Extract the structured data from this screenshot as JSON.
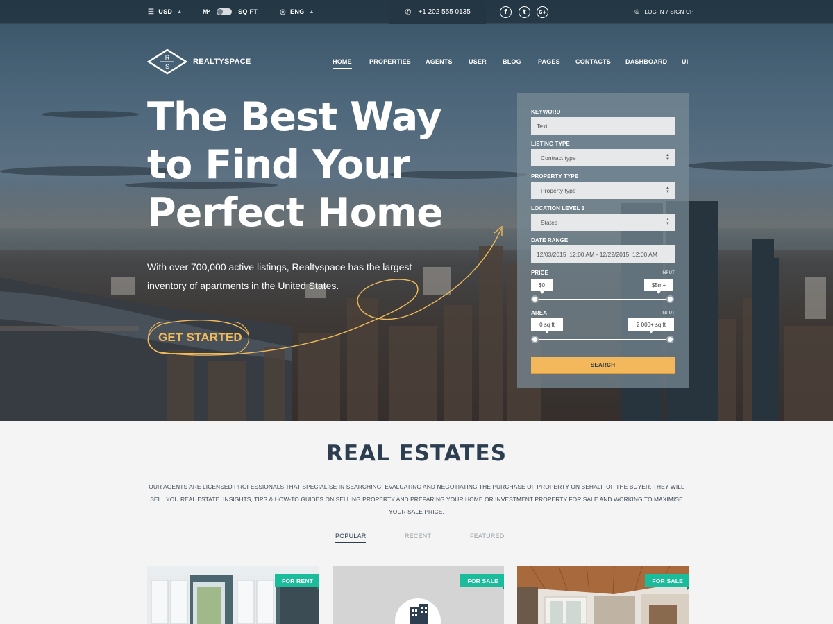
{
  "topbar": {
    "currency": "USD",
    "unit_left": "M²",
    "unit_right": "SQ FT",
    "language": "ENG",
    "phone": "+1 202 555 0135",
    "social": [
      "f",
      "t",
      "G+"
    ],
    "login": "LOG IN",
    "signup": "SIGN UP"
  },
  "brand": {
    "name": "REALTYSPACE",
    "logo_letters": [
      "R",
      "S"
    ]
  },
  "nav": [
    "HOME",
    "PROPERTIES",
    "AGENTS",
    "USER",
    "BLOG",
    "PAGES",
    "CONTACTS",
    "DASHBOARD",
    "UI"
  ],
  "hero": {
    "headline": [
      "The Best Way",
      "to Find Your",
      "Perfect Home"
    ],
    "subtext": "With over 700,000 active listings, Realtyspace has the largest inventory of apartments in the United States.",
    "cta": "GET STARTED"
  },
  "search": {
    "keyword_label": "KEYWORD",
    "keyword_placeholder": "Text",
    "listing_label": "LISTING TYPE",
    "listing_value": "Contract type",
    "property_label": "PROPERTY TYPE",
    "property_value": "Property type",
    "location_label": "LOCATION LEVEL 1",
    "location_value": "States",
    "date_label": "DATE RANGE",
    "date_value": "12/03/2015  12:00 AM - 12/22/2015  12:00 AM",
    "price_label": "PRICE",
    "price_input_label": "INPUT",
    "price_min": "$0",
    "price_max": "$5m+",
    "area_label": "AREA",
    "area_input_label": "INPUT",
    "area_min": "0 sq ft",
    "area_max": "2 000+ sq ft",
    "button": "SEARCH"
  },
  "section": {
    "title": "REAL ESTATES",
    "description": "OUR AGENTS ARE LICENSED PROFESSIONALS THAT SPECIALISE IN SEARCHING, EVALUATING AND NEGOTIATING THE PURCHASE OF PROPERTY ON BEHALF OF THE BUYER. THEY WILL SELL YOU REAL ESTATE. INSIGHTS, TIPS & HOW-TO GUIDES ON SELLING PROPERTY AND PREPARING YOUR HOME OR INVESTMENT PROPERTY FOR SALE AND WORKING TO MAXIMISE YOUR SALE PRICE.",
    "tabs": [
      "POPULAR",
      "RECENT",
      "FEATURED"
    ]
  },
  "cards": [
    {
      "badge": "FOR RENT"
    },
    {
      "badge": "FOR SALE"
    },
    {
      "badge": "FOR SALE"
    }
  ],
  "colors": {
    "accent": "#f0b95a",
    "badge": "#1bbc9b",
    "heading": "#2c3e50"
  }
}
